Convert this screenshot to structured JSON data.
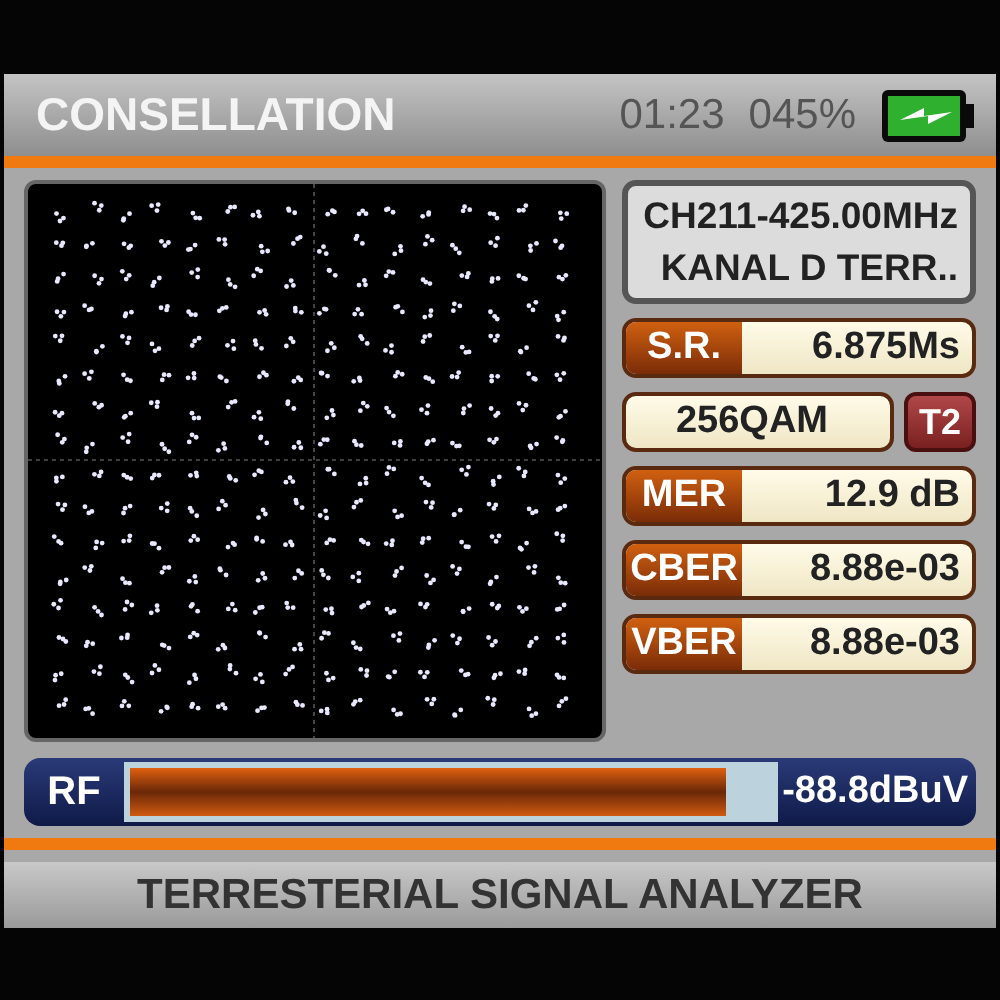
{
  "header": {
    "title": "CONSELLATION",
    "time": "01:23",
    "battery_percent": "045%"
  },
  "channel": {
    "frequency": "CH211-425.00MHz",
    "name": "KANAL D TERR.."
  },
  "measurements": [
    {
      "kind": "labeled",
      "label": "S.R.",
      "value": "6.875Ms"
    },
    {
      "kind": "badged",
      "value": "256QAM",
      "badge": "T2"
    },
    {
      "kind": "labeled",
      "label": "MER",
      "value": "12.9 dB"
    },
    {
      "kind": "labeled",
      "label": "CBER",
      "value": "8.88e-03"
    },
    {
      "kind": "labeled",
      "label": "VBER",
      "value": "8.88e-03"
    }
  ],
  "rf": {
    "label": "RF",
    "level": 0.93,
    "reading": "-88.8dBuV"
  },
  "footer": "TERRESTERIAL SIGNAL ANALYZER"
}
